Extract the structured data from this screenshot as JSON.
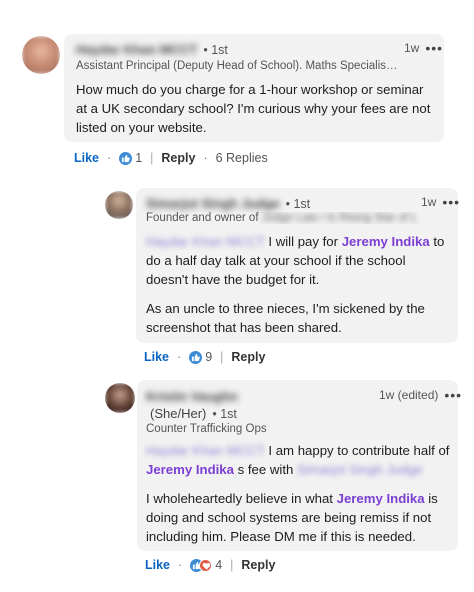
{
  "comment1": {
    "author": "Haydar Khan MCCT",
    "degree": "• 1st",
    "time": "1w",
    "more": "•••",
    "headline": "Assistant Principal (Deputy Head of School). Maths Specialis…",
    "body": "How much do you charge for a 1-hour workshop or seminar at a UK secondary school? I'm curious why your fees are not listed on your website.",
    "like": "Like",
    "reactions": "1",
    "reply": "Reply",
    "replies": "6 Replies"
  },
  "reply1": {
    "author": "Simarjot Singh Judge",
    "degree": "• 1st",
    "time": "1w",
    "more": "•••",
    "headline_prefix": "Founder and owner of",
    "headline_blur": "Judge Law / Is Rising Star of L",
    "mention_blur": "Haydar Khan MCCT",
    "body_a": " I will pay for ",
    "mention": "Jeremy Indika",
    "body_b": " to do a half day talk at your school if the school doesn't have the budget for it.",
    "body_c": "As an uncle to three nieces, I'm sickened by the screenshot that has been shared.",
    "like": "Like",
    "reactions": "9",
    "reply": "Reply"
  },
  "reply2": {
    "author": "Kristin Vaughn",
    "pronouns": "(She/Her)",
    "degree": "• 1st",
    "time": "1w (edited)",
    "more": "•••",
    "headline": "Counter Trafficking Ops",
    "mention_blur": "Haydar Khan MCCT",
    "body_a": " I am happy to contribute half of ",
    "mention": "Jeremy Indika",
    "body_b": " s fee with ",
    "mention_blur2": "Simarjot Singh Judge",
    "body_c_a": "I wholeheartedly believe in what ",
    "body_c_mention": "Jeremy Indika",
    "body_c_b": " is doing and school systems are being remiss if not including him. Please DM me if this is needed.",
    "like": "Like",
    "reactions": "4",
    "reply": "Reply"
  }
}
